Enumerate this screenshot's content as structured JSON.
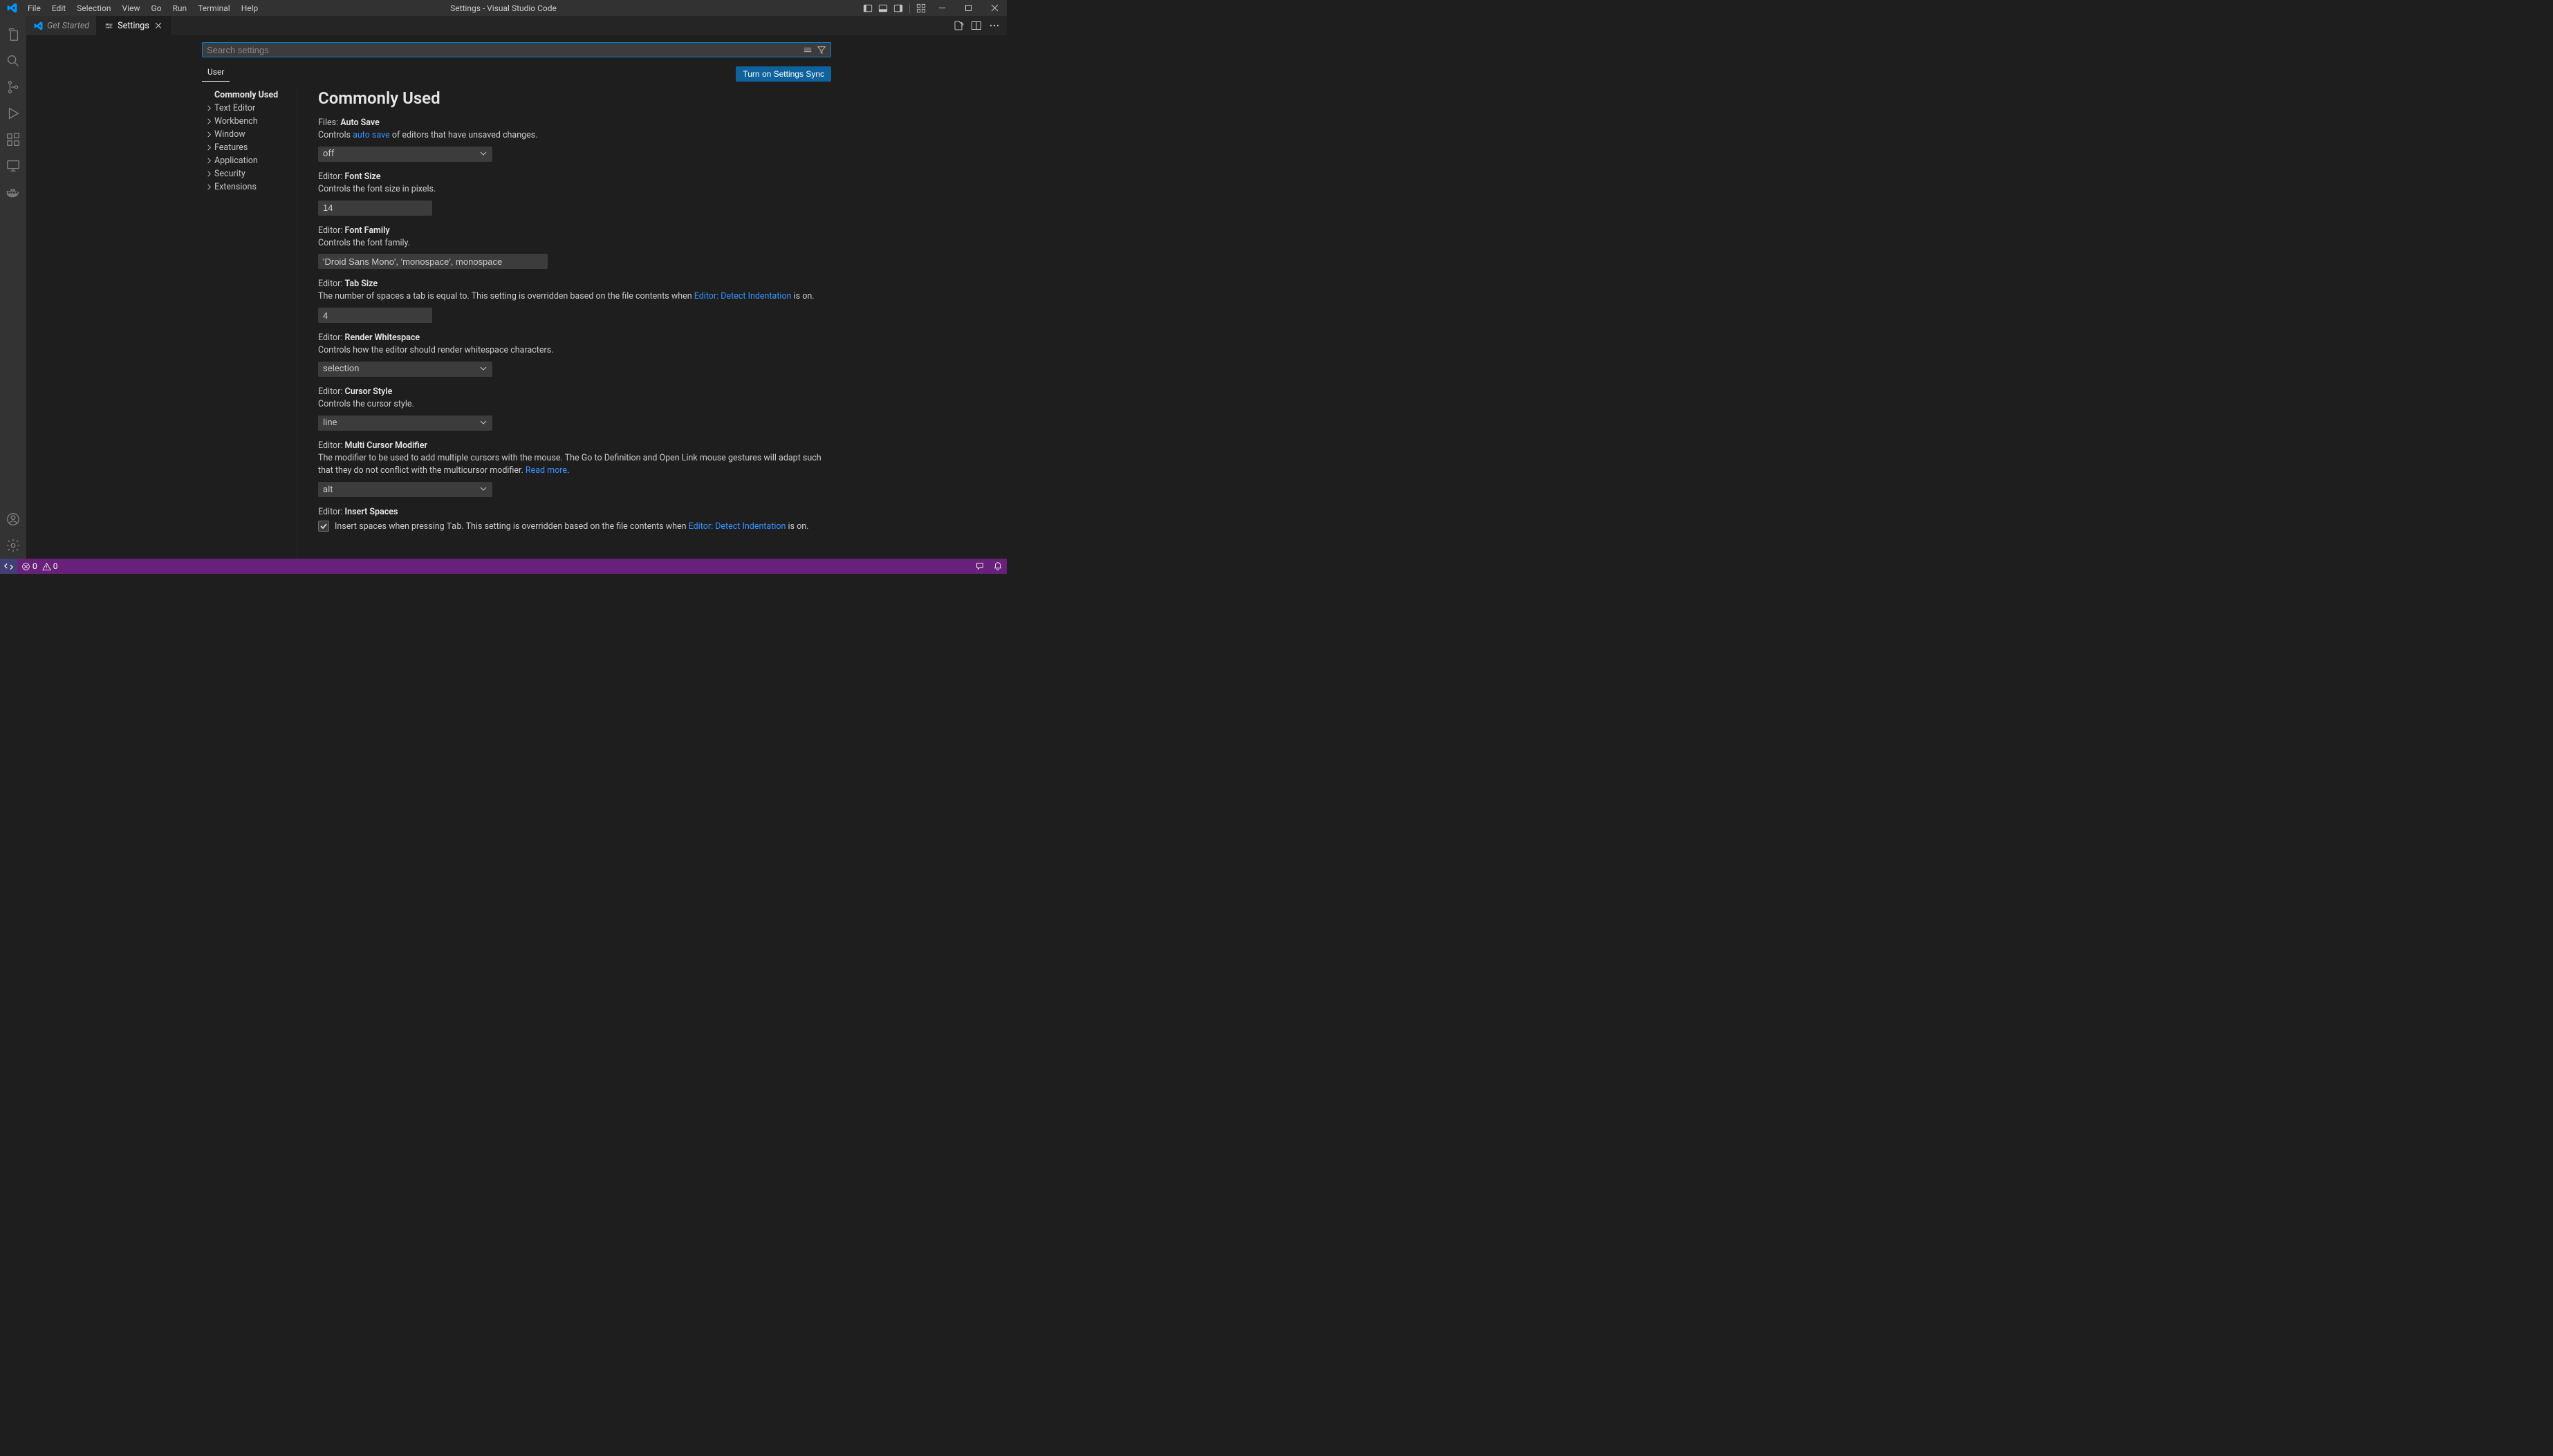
{
  "titlebar": {
    "title": "Settings - Visual Studio Code"
  },
  "menu": [
    "File",
    "Edit",
    "Selection",
    "View",
    "Go",
    "Run",
    "Terminal",
    "Help"
  ],
  "tabs": {
    "inactive": {
      "label": "Get Started"
    },
    "active": {
      "label": "Settings"
    }
  },
  "search": {
    "placeholder": "Search settings"
  },
  "scope": {
    "user_label": "User",
    "sync_label": "Turn on Settings Sync"
  },
  "toc": [
    {
      "label": "Commonly Used",
      "active": true,
      "expandable": false
    },
    {
      "label": "Text Editor",
      "active": false,
      "expandable": true
    },
    {
      "label": "Workbench",
      "active": false,
      "expandable": true
    },
    {
      "label": "Window",
      "active": false,
      "expandable": true
    },
    {
      "label": "Features",
      "active": false,
      "expandable": true
    },
    {
      "label": "Application",
      "active": false,
      "expandable": true
    },
    {
      "label": "Security",
      "active": false,
      "expandable": true
    },
    {
      "label": "Extensions",
      "active": false,
      "expandable": true
    }
  ],
  "heading": "Commonly Used",
  "settings": {
    "autosave": {
      "prefix": "Files: ",
      "name": "Auto Save",
      "desc_pre": "Controls ",
      "desc_link": "auto save",
      "desc_post": " of editors that have unsaved changes.",
      "value": "off"
    },
    "fontsize": {
      "prefix": "Editor: ",
      "name": "Font Size",
      "desc": "Controls the font size in pixels.",
      "value": "14"
    },
    "fontfamily": {
      "prefix": "Editor: ",
      "name": "Font Family",
      "desc": "Controls the font family.",
      "value": "'Droid Sans Mono', 'monospace', monospace"
    },
    "tabsize": {
      "prefix": "Editor: ",
      "name": "Tab Size",
      "desc_pre": "The number of spaces a tab is equal to. This setting is overridden based on the file contents when ",
      "desc_link": "Editor: Detect Indentation",
      "desc_post": " is on.",
      "value": "4"
    },
    "whitespace": {
      "prefix": "Editor: ",
      "name": "Render Whitespace",
      "desc": "Controls how the editor should render whitespace characters.",
      "value": "selection"
    },
    "cursorstyle": {
      "prefix": "Editor: ",
      "name": "Cursor Style",
      "desc": "Controls the cursor style.",
      "value": "line"
    },
    "multicursor": {
      "prefix": "Editor: ",
      "name": "Multi Cursor Modifier",
      "desc_pre": "The modifier to be used to add multiple cursors with the mouse. The Go to Definition and Open Link mouse gestures will adapt such that they do not conflict with the multicursor modifier. ",
      "desc_link": "Read more",
      "desc_post": ".",
      "value": "alt"
    },
    "insertspaces": {
      "prefix": "Editor: ",
      "name": "Insert Spaces",
      "label_pre": "Insert spaces when pressing ",
      "label_code": "Tab",
      "label_mid": ". This setting is overridden based on the file contents when ",
      "label_link": "Editor: Detect Indentation",
      "label_post": " is on."
    }
  },
  "status": {
    "errors": "0",
    "warnings": "0"
  }
}
